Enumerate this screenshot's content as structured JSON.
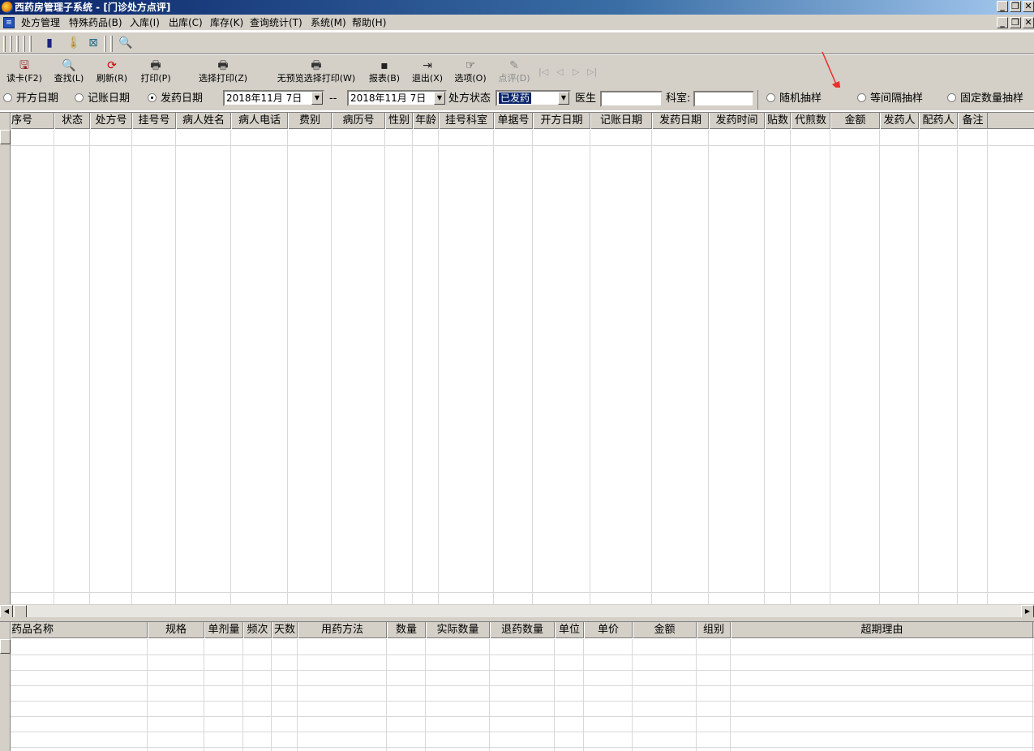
{
  "window": {
    "title": "西药房管理子系统 - [门诊处方点评]",
    "controls": [
      "_",
      "❐",
      "✕"
    ]
  },
  "menu": {
    "items": [
      "处方管理",
      "特殊药品(B)",
      "入库(I)",
      "出库(C)",
      "库存(K)",
      "查询统计(T)",
      "系统(M)",
      "帮助(H)"
    ],
    "mdi_controls": [
      "_",
      "❐",
      "✕"
    ]
  },
  "toolbar": {
    "buttons": [
      {
        "label": "读卡(F2)",
        "icon": "card-reader-icon",
        "glyph": "🖫",
        "color": "#8b1a1a"
      },
      {
        "label": "查找(L)",
        "icon": "search-icon",
        "glyph": "🔍",
        "color": "#1a3a8b"
      },
      {
        "label": "刷新(R)",
        "icon": "refresh-icon",
        "glyph": "⟳",
        "color": "#cc0000"
      },
      {
        "label": "打印(P)",
        "icon": "printer-icon",
        "glyph": "🖶",
        "color": "#333333"
      },
      {
        "label": "选择打印(Z)",
        "icon": "printer-icon",
        "glyph": "🖶",
        "color": "#333333"
      },
      {
        "label": "无预览选择打印(W)",
        "icon": "printer-icon",
        "glyph": "🖶",
        "color": "#333333"
      },
      {
        "label": "报表(B)",
        "icon": "save-icon",
        "glyph": "▪",
        "color": "#222222"
      },
      {
        "label": "退出(X)",
        "icon": "exit-door-icon",
        "glyph": "⇥",
        "color": "#222222"
      },
      {
        "label": "选项(O)",
        "icon": "options-icon",
        "glyph": "☞",
        "color": "#222222"
      },
      {
        "label": "点评(D)",
        "icon": "review-icon",
        "glyph": "✎",
        "color": "#8a8a8a",
        "disabled": true
      }
    ],
    "nav": [
      "|◁",
      "◁",
      "▷",
      "▷|"
    ]
  },
  "filters": {
    "date_types": [
      {
        "label": "开方日期",
        "checked": false
      },
      {
        "label": "记账日期",
        "checked": false
      },
      {
        "label": "发药日期",
        "checked": true
      }
    ],
    "start_date": "2018年11月 7日",
    "separator": "--",
    "end_date": "2018年11月 7日",
    "status_label": "处方状态",
    "status_value": "已发药",
    "doctor_label": "医生",
    "doctor_value": "",
    "dept_label": "科室:",
    "dept_value": "",
    "sampling": [
      {
        "label": "随机抽样",
        "checked": false
      },
      {
        "label": "等间隔抽样",
        "checked": false
      },
      {
        "label": "固定数量抽样",
        "checked": false
      }
    ]
  },
  "prescriptions_table": {
    "columns": [
      "序号",
      "状态",
      "处方号",
      "挂号号",
      "病人姓名",
      "病人电话",
      "费别",
      "病历号",
      "性别",
      "年龄",
      "挂号科室",
      "单据号",
      "开方日期",
      "记账日期",
      "发药日期",
      "发药时间",
      "贴数",
      "代煎数",
      "金额",
      "发药人",
      "配药人",
      "备注"
    ],
    "rows": []
  },
  "detail_table": {
    "columns": [
      "药品名称",
      "规格",
      "单剂量",
      "频次",
      "天数",
      "用药方法",
      "数量",
      "实际数量",
      "退药数量",
      "单位",
      "单价",
      "金额",
      "组别",
      "超期理由"
    ],
    "rows": []
  },
  "colors": {
    "face": "#d4d0c8",
    "title_start": "#0a246a",
    "selection": "#0a246a",
    "annotation_arrow": "#e8302a"
  }
}
